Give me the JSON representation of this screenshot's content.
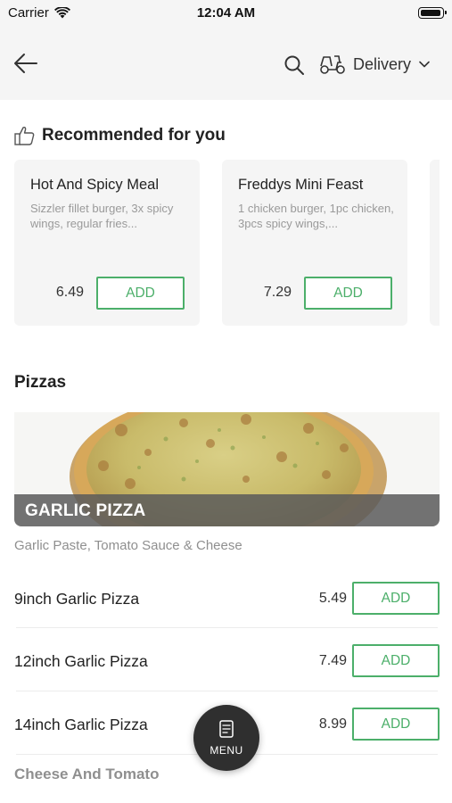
{
  "status_bar": {
    "carrier": "Carrier",
    "time": "12:04 AM"
  },
  "header": {
    "delivery_label": "Delivery"
  },
  "recommended": {
    "title": "Recommended for you",
    "items": [
      {
        "name": "Hot And Spicy Meal",
        "description": "Sizzler fillet burger, 3x spicy wings, regular fries...",
        "price": "6.49",
        "add_label": "ADD"
      },
      {
        "name": "Freddys Mini Feast",
        "description": "1 chicken burger, 1pc chicken, 3pcs spicy wings,...",
        "price": "7.29",
        "add_label": "ADD"
      }
    ]
  },
  "pizzas": {
    "title": "Pizzas",
    "banner_label": "GARLIC PIZZA",
    "description": "Garlic Paste, Tomato Sauce & Cheese",
    "items": [
      {
        "name": "9inch Garlic Pizza",
        "price": "5.49",
        "add_label": "ADD"
      },
      {
        "name": "12inch Garlic Pizza",
        "price": "7.49",
        "add_label": "ADD"
      },
      {
        "name": "14inch Garlic Pizza",
        "price": "8.99",
        "add_label": "ADD"
      }
    ]
  },
  "next_section": {
    "title": "Cheese And Tomato"
  },
  "menu_button": {
    "label": "MENU"
  },
  "colors": {
    "accent": "#4caf6a",
    "header_bg": "#f5f5f5",
    "card_bg": "#f5f5f5",
    "fab_bg": "#2f2f2f"
  },
  "icons": [
    "wifi-icon",
    "battery-icon",
    "back-arrow-icon",
    "search-icon",
    "scooter-icon",
    "chevron-down-icon",
    "thumbs-up-icon",
    "menu-book-icon"
  ]
}
